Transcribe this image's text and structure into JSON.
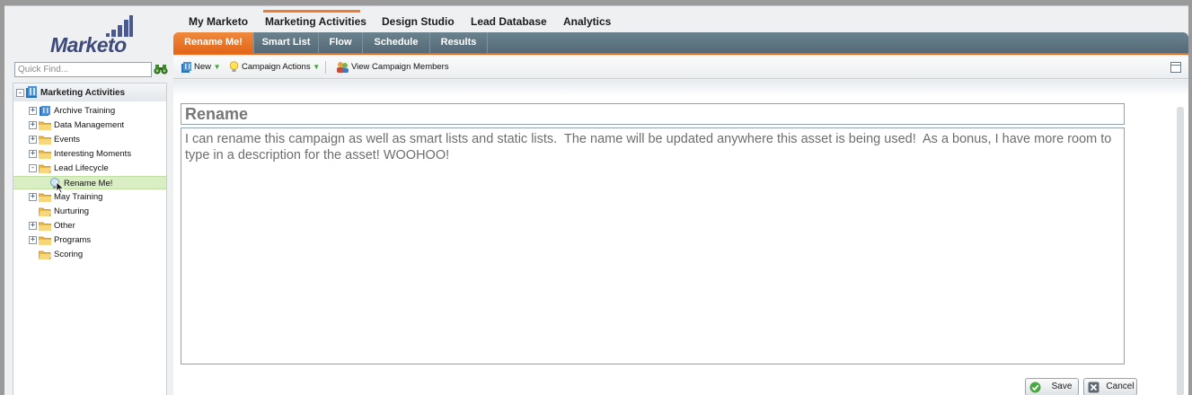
{
  "app": {
    "brand": "Marketo",
    "quick_find_placeholder": "Quick Find..."
  },
  "topnav": {
    "items": [
      "My Marketo",
      "Marketing Activities",
      "Design Studio",
      "Lead Database",
      "Analytics"
    ],
    "active_index": 1,
    "accent": "#ee7d31"
  },
  "subtabs": {
    "items": [
      "Rename Me!",
      "Smart List",
      "Flow",
      "Schedule",
      "Results"
    ],
    "active_index": 0
  },
  "toolbar": {
    "new_label": "New",
    "campaign_actions_label": "Campaign Actions",
    "view_members_label": "View Campaign Members"
  },
  "tree": {
    "root": "Marketing Activities",
    "items": [
      {
        "label": "Archive Training",
        "icon": "program-icon"
      },
      {
        "label": "Data Management",
        "icon": "folder-icon"
      },
      {
        "label": "Events",
        "icon": "folder-icon"
      },
      {
        "label": "Interesting Moments",
        "icon": "folder-icon"
      },
      {
        "label": "Lead Lifecycle",
        "icon": "folder-icon"
      },
      {
        "label": "Rename Me!",
        "icon": "campaign-icon"
      },
      {
        "label": "May Training",
        "icon": "folder-icon"
      },
      {
        "label": "Nurturing",
        "icon": "folder-icon"
      },
      {
        "label": "Other",
        "icon": "folder-icon"
      },
      {
        "label": "Programs",
        "icon": "folder-icon"
      },
      {
        "label": "Scoring",
        "icon": "folder-icon"
      }
    ]
  },
  "editor": {
    "name_value": "Rename",
    "description_value": "I can rename this campaign as well as smart lists and static lists.  The name will be updated anywhere this asset is being used!  As a bonus, I have more room to type in a description for the asset! WOOHOO!",
    "save_label": "Save",
    "cancel_label": "Cancel"
  }
}
